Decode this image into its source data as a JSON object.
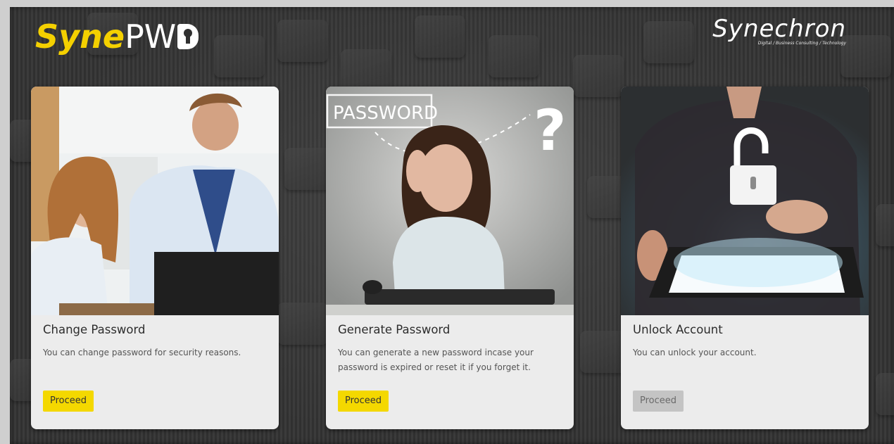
{
  "header": {
    "logo_left": {
      "part1": "Syne",
      "part2": "PW"
    },
    "logo_right": {
      "name": "Synechron",
      "tagline": "Digital / Business Consulting / Technology"
    }
  },
  "colors": {
    "brand_yellow": "#f4d800",
    "card_bg": "#ececec",
    "disabled_button": "#c4c4c4",
    "background_dark": "#333333"
  },
  "cards": [
    {
      "title": "Change Password",
      "description": "You can change password for security reasons.",
      "button_label": "Proceed",
      "button_state": "enabled",
      "image": "couple-at-laptop-photo"
    },
    {
      "title": "Generate Password",
      "description": "You can generate a new password incase your password is expired or reset it if you forget it.",
      "button_label": "Proceed",
      "button_state": "enabled",
      "image": "confused-woman-password-photo",
      "image_text": "PASSWORD"
    },
    {
      "title": "Unlock Account",
      "description": "You can unlock your account.",
      "button_label": "Proceed",
      "button_state": "disabled",
      "image": "padlock-tablet-photo"
    }
  ]
}
